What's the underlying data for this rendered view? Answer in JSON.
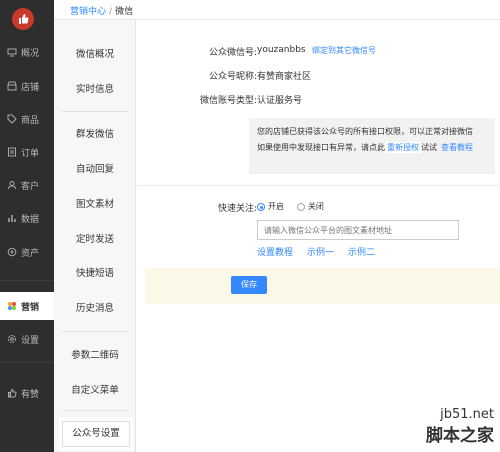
{
  "breadcrumb": {
    "parent": "营销中心",
    "separator": "/",
    "current": "微信"
  },
  "nav": {
    "items": [
      {
        "label": "概况",
        "icon": "monitor-icon"
      },
      {
        "label": "店铺",
        "icon": "store-icon"
      },
      {
        "label": "商品",
        "icon": "tag-icon"
      },
      {
        "label": "订单",
        "icon": "list-icon"
      },
      {
        "label": "客户",
        "icon": "user-icon"
      },
      {
        "label": "数据",
        "icon": "bar-chart-icon"
      },
      {
        "label": "资产",
        "icon": "wallet-icon"
      },
      {
        "label": "营销",
        "icon": "flower-icon"
      },
      {
        "label": "设置",
        "icon": "gear-icon"
      },
      {
        "label": "有赞",
        "icon": "thumbs-up-icon"
      }
    ]
  },
  "subnav": {
    "items": [
      "微信概况",
      "实时信息",
      "群发微信",
      "自动回复",
      "图文素材",
      "定时发送",
      "快捷短语",
      "历史消息",
      "参数二维码",
      "自定义菜单",
      "公众号设置"
    ]
  },
  "account": {
    "id_label": "公众微信号:",
    "id_value": "youzanbbs",
    "bind_button": "绑定到其它微信号",
    "name_label": "公众号昵称:",
    "name_value": "有赞商家社区",
    "type_label": "微信账号类型:",
    "type_value": "认证服务号"
  },
  "notice": {
    "line1": "您的店铺已获得该公众号的所有接口权限，可以正常对接微信",
    "line2_prefix": "如果使用中发现接口有异常，请点此",
    "reauth": "重新授权",
    "line2_suffix": "试试",
    "tutorial": "查看教程"
  },
  "follow": {
    "label": "快速关注:",
    "on_label": "开启",
    "off_label": "关闭",
    "selected": "on",
    "url_placeholder": "请输入微信公众平台的图文素材地址",
    "links": [
      "设置教程",
      "示例一",
      "示例二"
    ]
  },
  "save_label": "保存",
  "watermark": {
    "line1": "jb51.net",
    "line2": "脚本之家"
  },
  "colors": {
    "accent": "#3388ff",
    "sidebar": "#2e2e2e",
    "logo": "#c93a2b"
  }
}
